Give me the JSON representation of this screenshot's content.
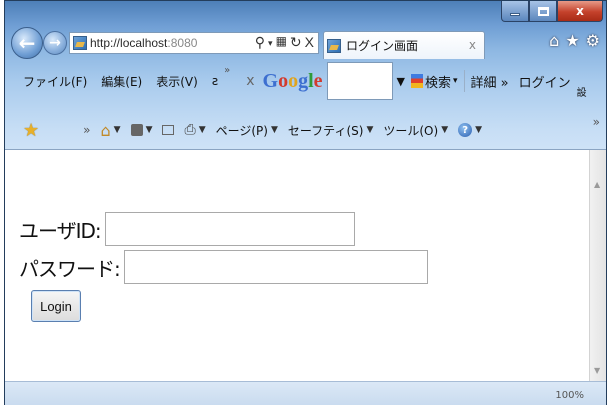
{
  "window": {
    "caption": {
      "minimize": "",
      "maximize": "",
      "close": "x"
    }
  },
  "nav": {
    "back_icon": "back-arrow-icon",
    "forward_icon": "forward-arrow-icon",
    "address_prefix": "http://",
    "address_host": "localhost",
    "address_port": ":8080",
    "search_icon": "magnifier-icon",
    "dropdown_icon": "dropdown-icon",
    "compat_icon": "compatibility-icon",
    "refresh_icon": "refresh-icon",
    "stop_label": "X",
    "tab_title": "ログイン画面",
    "tab_close": "x",
    "home_icon": "home-icon",
    "favorites_icon": "star-icon",
    "tools_icon": "gear-icon"
  },
  "menu": {
    "items": [
      "ファイル(F)",
      "編集(E)",
      "表示(V)",
      "ƨ"
    ],
    "overflow": "»",
    "google_close": "x",
    "google_logo": [
      "G",
      "o",
      "o",
      "g",
      "l",
      "e"
    ],
    "google_search_value": "",
    "google_dropdown": "▼",
    "google_search_label": "検索",
    "google_search_caret": "▾",
    "detail_label": "詳細 »",
    "login_label": "ログイン",
    "settings_fragment": "設"
  },
  "commands": {
    "overflow": "»",
    "page_label": "ページ(P)",
    "safety_label": "セーフティ(S)",
    "tools_label": "ツール(O)",
    "help_label": "?",
    "caret": "▼",
    "right_overflow": "»"
  },
  "form": {
    "user_label": "ユーザID:",
    "user_value": "",
    "password_label": "パスワード:",
    "password_value": "",
    "login_label": "Login"
  },
  "status": {
    "zoom_text": "100%"
  },
  "colors": {
    "chrome_top": "#4d7fb8",
    "chrome_bottom": "#dbe9f8",
    "close_red": "#c4412b",
    "button_border": "#5a7fb0"
  }
}
